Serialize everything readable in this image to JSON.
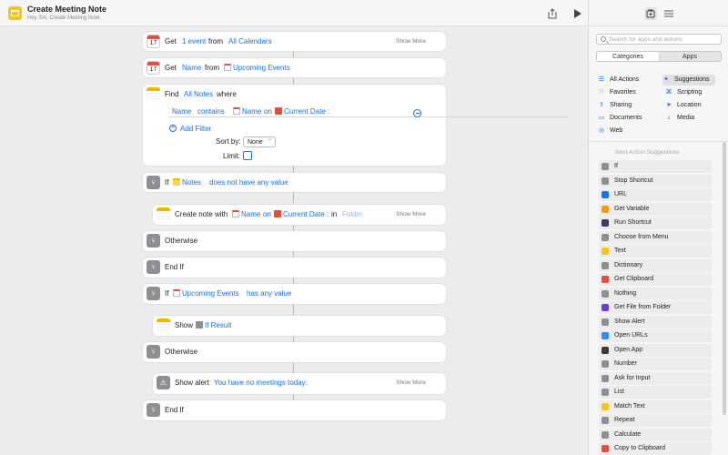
{
  "window": {
    "title": "Create Meeting Note",
    "subtitle": "Hey Siri, Create Meeting Note"
  },
  "actions": {
    "a1": {
      "get": "Get",
      "t1": "1 event",
      "from": "from",
      "t2": "All Calendars",
      "more": "Show More"
    },
    "a2": {
      "get": "Get",
      "t1": "Name",
      "from": "from",
      "t2": "Upcoming Events"
    },
    "a3": {
      "find": "Find",
      "t1": "All Notes",
      "where": "where",
      "filter": {
        "field": "Name",
        "op": "contains",
        "v1": "Name",
        "on": "on",
        "v2": "Current Date :"
      },
      "add_filter": "Add Filter",
      "sort_label": "Sort by:",
      "sort_value": "None",
      "limit_label": "Limit:"
    },
    "a4": {
      "if": "If",
      "t1": "Notes",
      "t2": "does not have any value"
    },
    "a5": {
      "label": "Create note with",
      "v1": "Name",
      "on": "on",
      "v2": "Current Date :",
      "in": "in",
      "folder": "Folder",
      "more": "Show More"
    },
    "a6": {
      "label": "Otherwise"
    },
    "a7": {
      "label": "End If"
    },
    "a8": {
      "if": "If",
      "t1": "Upcoming Events",
      "t2": "has any value"
    },
    "a9": {
      "label": "Show",
      "t1": "If Result"
    },
    "a10": {
      "label": "Otherwise"
    },
    "a11": {
      "label": "Show alert",
      "t1": "You have no meetings today.",
      "more": "Show More"
    },
    "a12": {
      "label": "End If"
    }
  },
  "sidebar": {
    "search_placeholder": "Search for apps and actions",
    "segments": [
      "Categories",
      "Apps"
    ],
    "categories_left": [
      "All Actions",
      "Favorites",
      "Sharing",
      "Documents",
      "Web"
    ],
    "categories_right": [
      "Suggestions",
      "Scripting",
      "Location",
      "Media"
    ],
    "suggestions_title": "Next Action Suggestions",
    "suggestions": [
      {
        "label": "If",
        "color": "#8e8e93"
      },
      {
        "label": "Stop Shortcut",
        "color": "#8e8e93"
      },
      {
        "label": "URL",
        "color": "#1a73e8"
      },
      {
        "label": "Get Variable",
        "color": "#f39c12"
      },
      {
        "label": "Run Shortcut",
        "color": "#3b3b5c"
      },
      {
        "label": "Choose from Menu",
        "color": "#8e8e93"
      },
      {
        "label": "Text",
        "color": "#f5c518"
      },
      {
        "label": "Dictionary",
        "color": "#8e8e93"
      },
      {
        "label": "Get Clipboard",
        "color": "#e74c3c"
      },
      {
        "label": "Nothing",
        "color": "#8e8e93"
      },
      {
        "label": "Get File from Folder",
        "color": "#6e3fd6"
      },
      {
        "label": "Show Alert",
        "color": "#8e8e93"
      },
      {
        "label": "Open URLs",
        "color": "#2d8cff"
      },
      {
        "label": "Open App",
        "color": "#3a3a3c"
      },
      {
        "label": "Number",
        "color": "#8e8e93"
      },
      {
        "label": "Ask for Input",
        "color": "#8e8e93"
      },
      {
        "label": "List",
        "color": "#8e8e93"
      },
      {
        "label": "Match Text",
        "color": "#f5c518"
      },
      {
        "label": "Repeat",
        "color": "#8e8e93"
      },
      {
        "label": "Calculate",
        "color": "#8e8e93"
      },
      {
        "label": "Copy to Clipboard",
        "color": "#e74c3c"
      }
    ]
  }
}
